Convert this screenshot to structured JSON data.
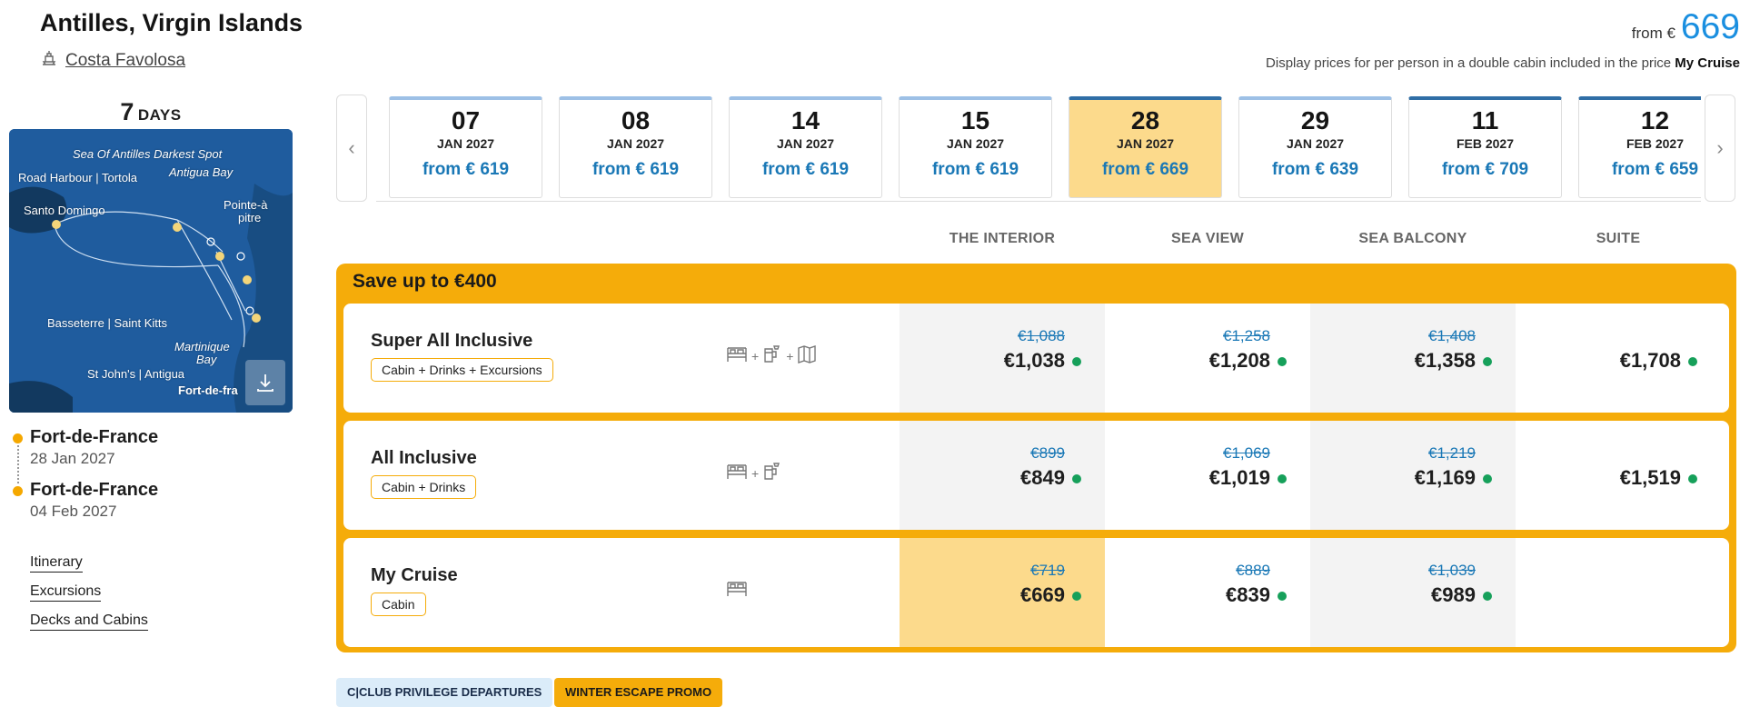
{
  "header": {
    "title": "Antilles, Virgin Islands",
    "ship": "Costa Favolosa",
    "from_label": "from €",
    "from_price": "669",
    "disclaimer_prefix": "Display prices for per person in a double cabin included in the price ",
    "disclaimer_bold": "My Cruise"
  },
  "duration": {
    "number": "7",
    "unit": "DAYS"
  },
  "map": {
    "labels": {
      "darkest_spot": "Sea Of Antilles Darkest Spot",
      "road_harbour": "Road Harbour | Tortola",
      "antigua_bay": "Antigua Bay",
      "santo_domingo": "Santo Domingo",
      "pointe_a_pitre_1": "Pointe-à",
      "pointe_a_pitre_2": "pitre",
      "basseterre": "Basseterre | Saint Kitts",
      "martinique_1": "Martinique",
      "martinique_2": "Bay",
      "st_johns": "St John's | Antigua",
      "fort_de_france": "Fort-de-fra"
    }
  },
  "itinerary": {
    "departure": {
      "port": "Fort-de-France",
      "date": "28 Jan 2027"
    },
    "arrival": {
      "port": "Fort-de-France",
      "date": "04 Feb 2027"
    }
  },
  "side_links": [
    "Itinerary",
    "Excursions",
    "Decks and Cabins"
  ],
  "dates": [
    {
      "day": "07",
      "month": "JAN 2027",
      "price": "from € 619"
    },
    {
      "day": "08",
      "month": "JAN 2027",
      "price": "from € 619"
    },
    {
      "day": "14",
      "month": "JAN 2027",
      "price": "from € 619"
    },
    {
      "day": "15",
      "month": "JAN 2027",
      "price": "from € 619"
    },
    {
      "day": "28",
      "month": "JAN 2027",
      "price": "from € 669"
    },
    {
      "day": "29",
      "month": "JAN 2027",
      "price": "from € 639"
    },
    {
      "day": "11",
      "month": "FEB 2027",
      "price": "from € 709"
    },
    {
      "day": "12",
      "month": "FEB 2027",
      "price": "from € 659"
    }
  ],
  "cabin_types": [
    "THE INTERIOR",
    "SEA VIEW",
    "SEA BALCONY",
    "SUITE"
  ],
  "save_banner": "Save up to €400",
  "packages": [
    {
      "name": "Super All Inclusive",
      "chip": "Cabin + Drinks + Excursions",
      "prices": [
        {
          "old": "€1,088",
          "new": "€1,038"
        },
        {
          "old": "€1,258",
          "new": "€1,208"
        },
        {
          "old": "€1,408",
          "new": "€1,358"
        },
        {
          "old": "",
          "new": "€1,708"
        }
      ]
    },
    {
      "name": "All Inclusive",
      "chip": "Cabin + Drinks",
      "prices": [
        {
          "old": "€899",
          "new": "€849"
        },
        {
          "old": "€1,069",
          "new": "€1,019"
        },
        {
          "old": "€1,219",
          "new": "€1,169"
        },
        {
          "old": "",
          "new": "€1,519"
        }
      ]
    },
    {
      "name": "My Cruise",
      "chip": "Cabin",
      "prices": [
        {
          "old": "€719",
          "new": "€669"
        },
        {
          "old": "€889",
          "new": "€839"
        },
        {
          "old": "€1,039",
          "new": "€989"
        }
      ]
    }
  ],
  "badges": {
    "club": "C|CLUB PRIVILEGE DEPARTURES",
    "promo": "WINTER ESCAPE PROMO"
  },
  "colors": {
    "accent_orange": "#f5ac0a",
    "price_blue": "#1a8fe0",
    "selected_date": "#fcda8c",
    "available_green": "#16a05a"
  }
}
